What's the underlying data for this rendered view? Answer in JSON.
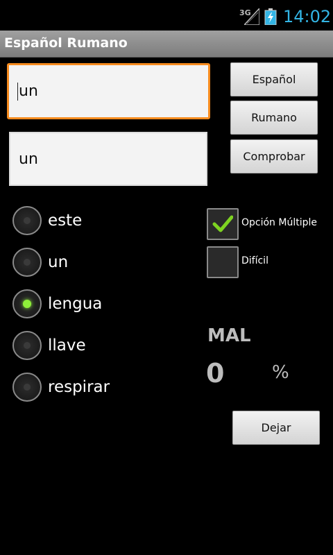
{
  "status_bar": {
    "network_label": "3G",
    "clock": "14:02",
    "clock_color": "#33b5e5"
  },
  "app": {
    "title": "Español Rumano"
  },
  "inputs": {
    "source_value": "un",
    "target_value": "un"
  },
  "buttons": {
    "espanol": "Español",
    "rumano": "Rumano",
    "comprobar": "Comprobar",
    "dejar": "Dejar"
  },
  "options": [
    {
      "label": "este",
      "selected": false
    },
    {
      "label": "un",
      "selected": false
    },
    {
      "label": "lengua",
      "selected": true
    },
    {
      "label": "llave",
      "selected": false
    },
    {
      "label": "respirar",
      "selected": false
    }
  ],
  "checkboxes": {
    "multiple_choice": {
      "label": "Opción Múltiple",
      "checked": true
    },
    "difficult": {
      "label": "Difícil",
      "checked": false
    }
  },
  "result": {
    "label": "MAL",
    "score": "0",
    "percent_sign": "%"
  },
  "colors": {
    "focus_border": "#f68b1e",
    "check_green": "#7ed321",
    "radio_on": "#8ef03a"
  }
}
